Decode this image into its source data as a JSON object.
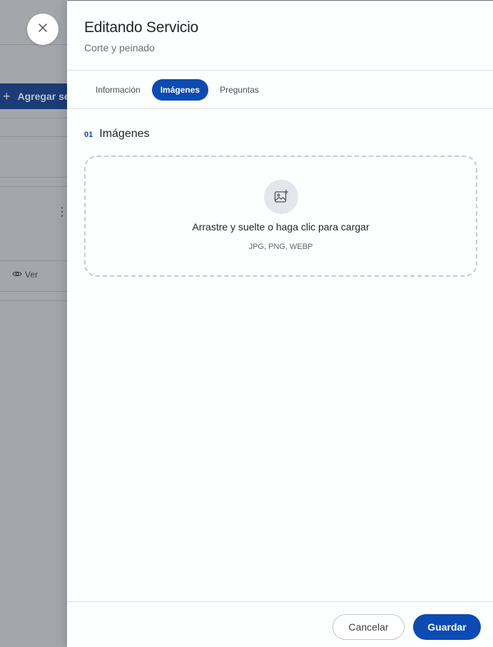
{
  "background": {
    "add_button_label": "Agregar se",
    "kebab_label": "⋮",
    "view_label": "Ver"
  },
  "drawer": {
    "title": "Editando Servicio",
    "subtitle": "Corte y peinado",
    "tabs": [
      {
        "label": "Información",
        "active": false
      },
      {
        "label": "Imágenes",
        "active": true
      },
      {
        "label": "Preguntas",
        "active": false
      }
    ],
    "section": {
      "number": "01",
      "title": "Imágenes"
    },
    "dropzone": {
      "instruction": "Arrastre y suelte o haga clic para cargar",
      "formats": "JPG, PNG, WEBP",
      "icon": "image-add-icon"
    },
    "footer": {
      "cancel_label": "Cancelar",
      "save_label": "Guardar"
    }
  },
  "colors": {
    "accent": "#0b4bb3",
    "backdrop": "#a3a6ab"
  }
}
